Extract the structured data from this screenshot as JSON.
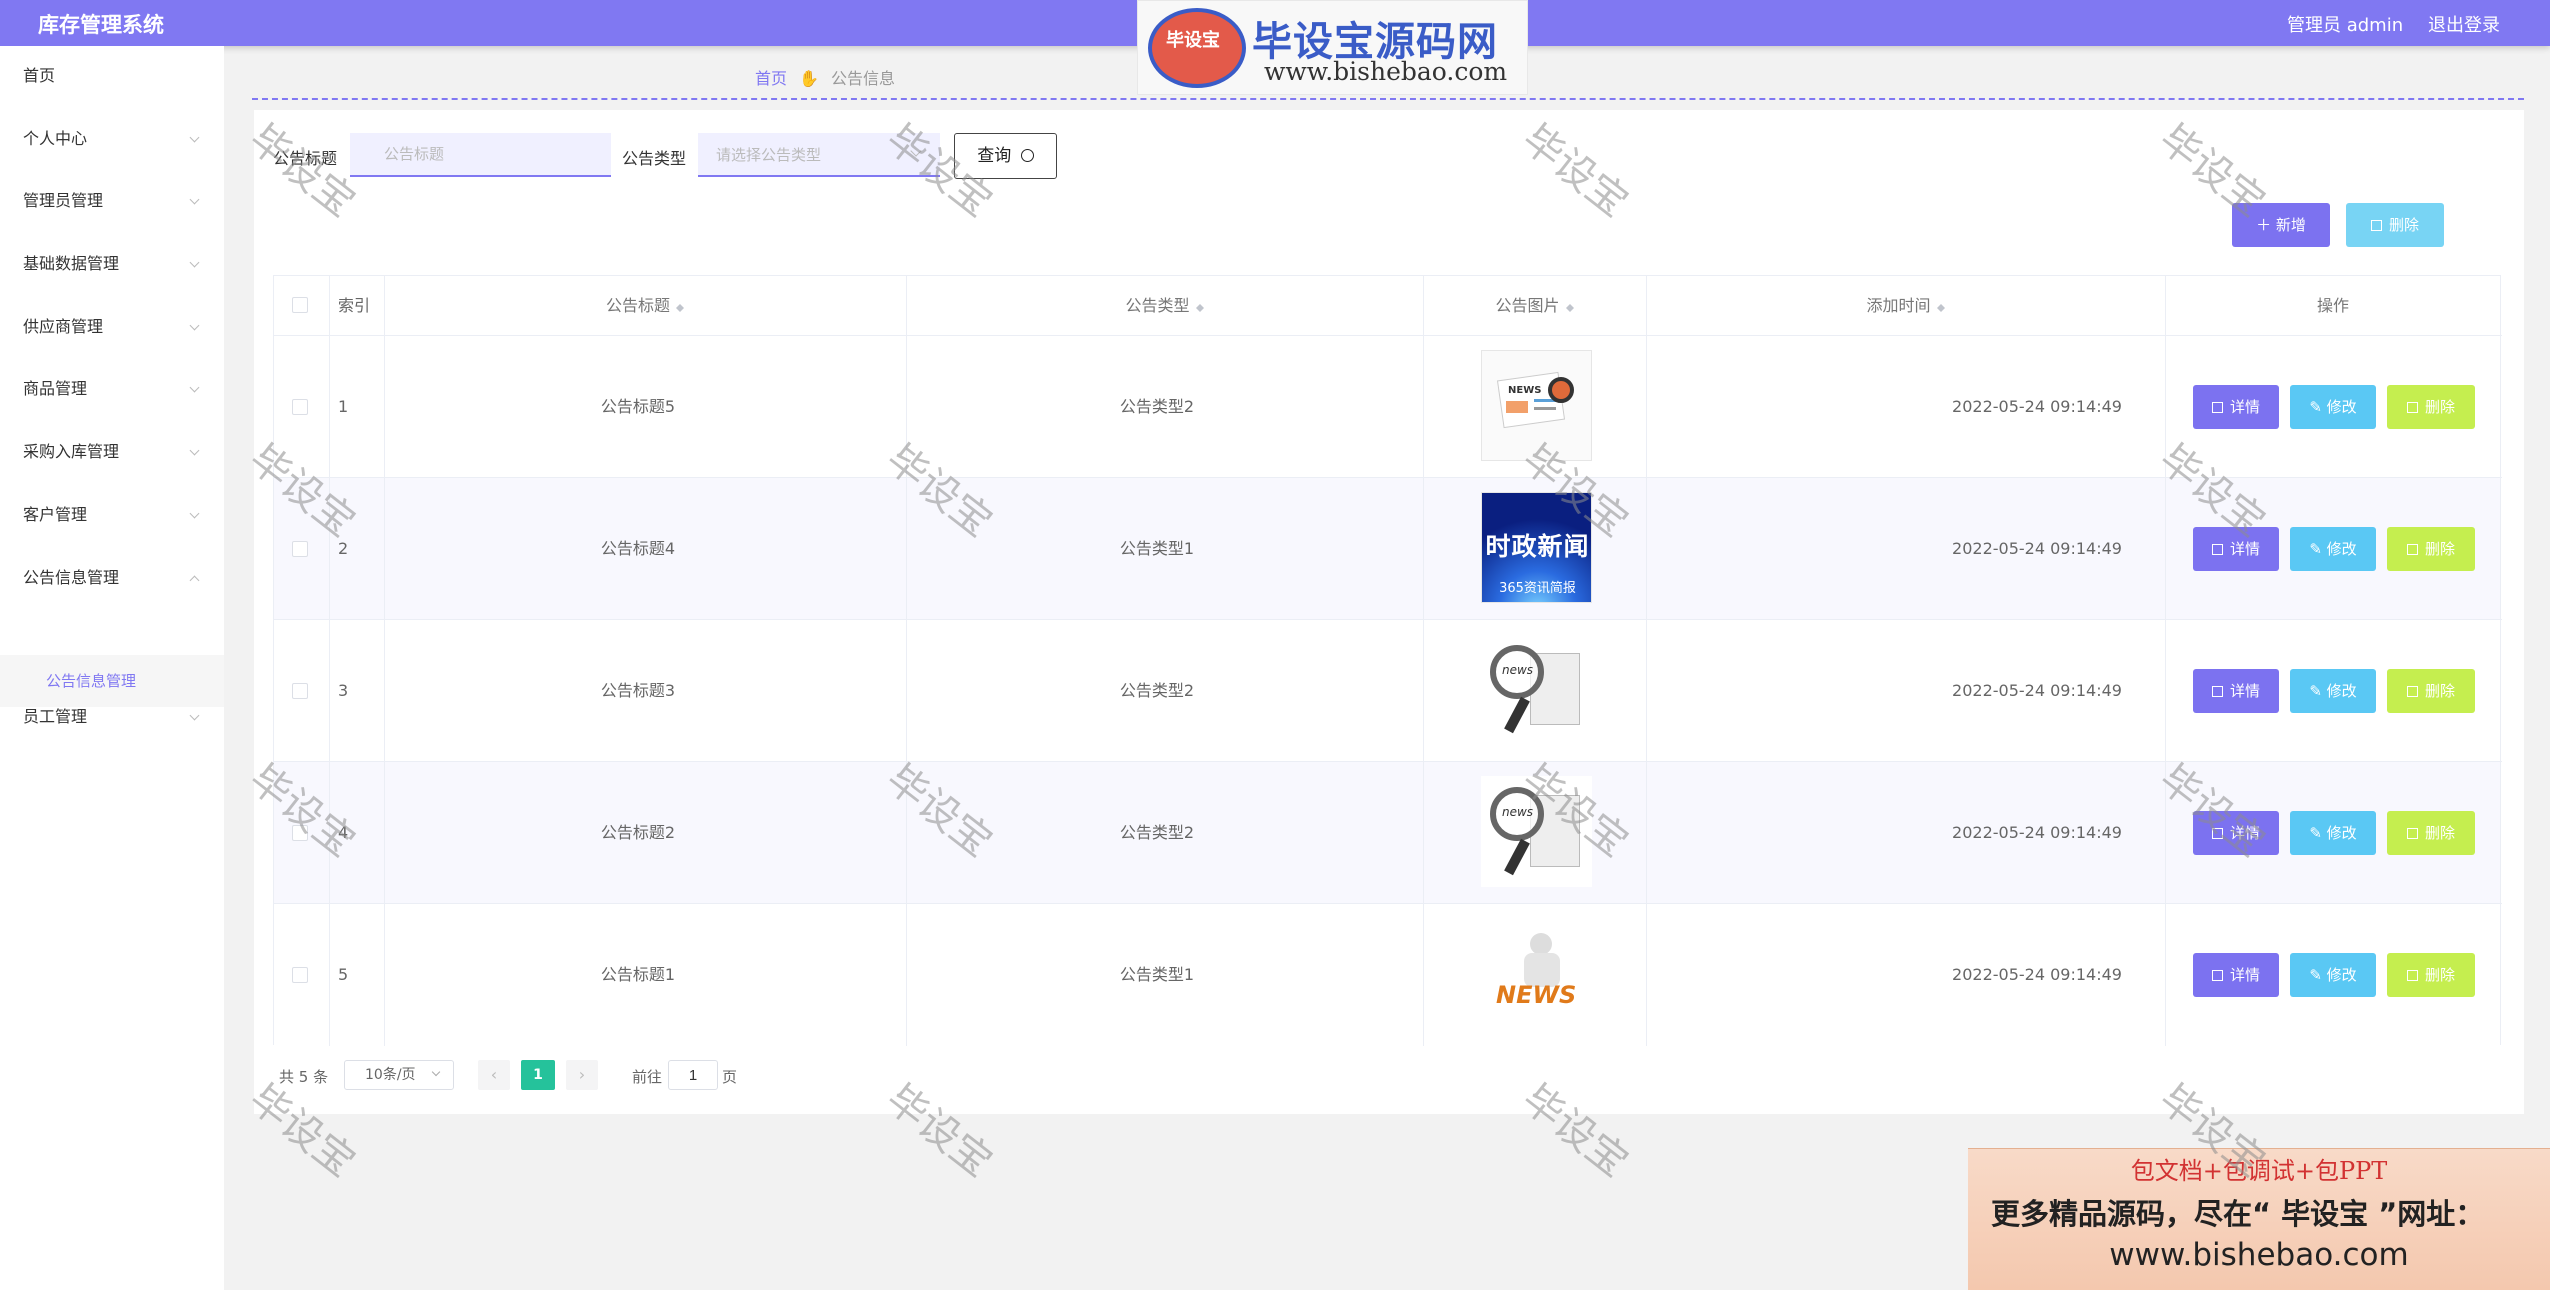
{
  "header": {
    "title": "库存管理系统",
    "user": "管理员 admin",
    "logout": "退出登录"
  },
  "sidebar": {
    "items": [
      {
        "label": "首页",
        "expandable": false
      },
      {
        "label": "个人中心",
        "expandable": true
      },
      {
        "label": "管理员管理",
        "expandable": true
      },
      {
        "label": "基础数据管理",
        "expandable": true
      },
      {
        "label": "供应商管理",
        "expandable": true
      },
      {
        "label": "商品管理",
        "expandable": true
      },
      {
        "label": "采购入库管理",
        "expandable": true
      },
      {
        "label": "客户管理",
        "expandable": true
      },
      {
        "label": "公告信息管理",
        "expandable": true,
        "expanded": true
      },
      {
        "label": "员工管理",
        "expandable": true
      }
    ],
    "submenu": "公告信息管理"
  },
  "breadcrumb": {
    "home": "首页",
    "current": "公告信息"
  },
  "search": {
    "title_label": "公告标题",
    "title_placeholder": "公告标题",
    "type_label": "公告类型",
    "type_placeholder": "请选择公告类型",
    "query_button": "查询"
  },
  "toolbar": {
    "add": "新增",
    "delete": "删除"
  },
  "table": {
    "headers": [
      "索引",
      "公告标题",
      "公告类型",
      "公告图片",
      "添加时间",
      "操作"
    ],
    "rows": [
      {
        "index": "1",
        "title": "公告标题5",
        "type": "公告类型2",
        "image": "news-desk",
        "time": "2022-05-24 09:14:49"
      },
      {
        "index": "2",
        "title": "公告标题4",
        "type": "公告类型1",
        "image": "shizheng-news",
        "time": "2022-05-24 09:14:49"
      },
      {
        "index": "3",
        "title": "公告标题3",
        "type": "公告类型2",
        "image": "news-magnifier",
        "time": "2022-05-24 09:14:49"
      },
      {
        "index": "4",
        "title": "公告标题2",
        "type": "公告类型2",
        "image": "news-magnifier",
        "time": "2022-05-24 09:14:49"
      },
      {
        "index": "5",
        "title": "公告标题1",
        "type": "公告类型1",
        "image": "news-figure",
        "time": "2022-05-24 09:14:49"
      }
    ],
    "actions": {
      "detail": "详情",
      "edit": "修改",
      "delete": "删除"
    }
  },
  "pagination": {
    "total": "共 5 条",
    "page_size": "10条/页",
    "current_page": "1",
    "jump_prefix": "前往",
    "jump_value": "1",
    "jump_suffix": "页"
  },
  "image_text": {
    "shizheng_title": "时政新闻",
    "shizheng_sub": "365资讯简报"
  },
  "watermark": {
    "logo_mark": "毕设宝",
    "title": "毕设宝源码网",
    "url": "www.bishebao.com",
    "text": "毕设宝",
    "promo_line1": "包文档+包调试+包PPT",
    "promo_line2": "更多精品源码，尽在“ 毕设宝 ”网址：",
    "promo_line3": "www.bishebao.com"
  },
  "colors": {
    "primary": "#8078f2",
    "teal": "#25c29b",
    "detail": "#7c72f0",
    "edit": "#5ac8f4",
    "delete": "#c5ee4f",
    "delete_top": "#78d4f4"
  }
}
